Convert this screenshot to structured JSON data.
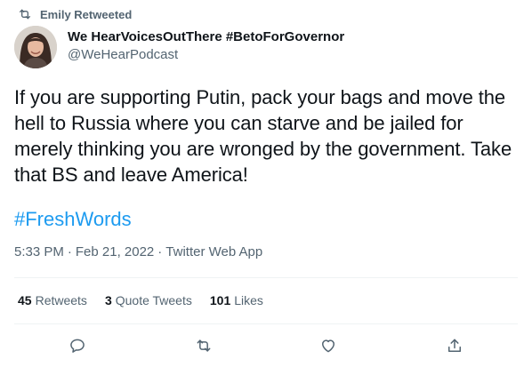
{
  "retweet_banner": {
    "text": "Emily Retweeted",
    "icon": "retweet-icon"
  },
  "author": {
    "display_name": "We HearVoicesOutThere #BetoForGovernor",
    "handle": "@WeHearPodcast",
    "avatar": "avatar"
  },
  "tweet": {
    "text": "If you are supporting Putin, pack your bags and move the hell to Russia where you can starve and be jailed for merely thinking you are wronged by the government. Take that BS and leave America!",
    "hashtag": "#FreshWords",
    "time": "5:33 PM",
    "separator": "·",
    "date": "Feb 21, 2022",
    "client": "Twitter Web App"
  },
  "stats": {
    "retweets": {
      "count": "45",
      "label": "Retweets"
    },
    "quote_tweets": {
      "count": "3",
      "label": "Quote Tweets"
    },
    "likes": {
      "count": "101",
      "label": "Likes"
    }
  },
  "actions": [
    "reply-icon",
    "retweet-icon",
    "like-icon",
    "share-icon"
  ],
  "colors": {
    "accent": "#1d9bf0",
    "secondary_text": "#536471",
    "primary_text": "#0f1419",
    "divider": "#eff3f4"
  }
}
